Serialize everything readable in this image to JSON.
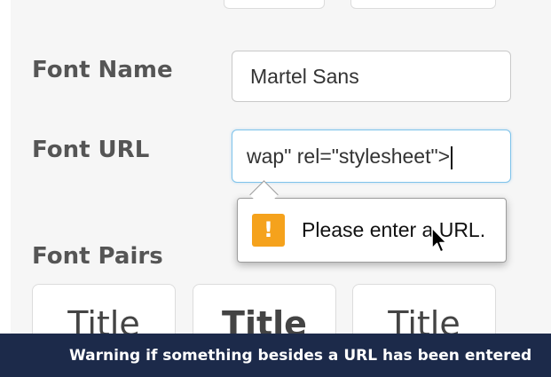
{
  "form": {
    "font_name": {
      "label": "Font Name",
      "value": "Martel Sans"
    },
    "font_url": {
      "label": "Font URL",
      "value_before_flag": "wap\" ",
      "value_flagged": "rel",
      "value_after_flag": "=\"stylesheet\">"
    },
    "validation_tooltip": {
      "icon": "warning-icon",
      "icon_glyph": "!",
      "icon_color": "#f5a21c",
      "message": "Please enter a URL."
    },
    "font_pairs": {
      "label": "Font Pairs",
      "cards": [
        {
          "title": "Title"
        },
        {
          "title": "Title"
        },
        {
          "title": "Title"
        }
      ]
    }
  },
  "caption": {
    "text": "Warning if something besides a URL has been entered",
    "background": "#1c2a4a"
  },
  "colors": {
    "focus_border": "#7fc3ea",
    "label_text": "#555555",
    "spellcheck_underline": "#e03a3a"
  }
}
